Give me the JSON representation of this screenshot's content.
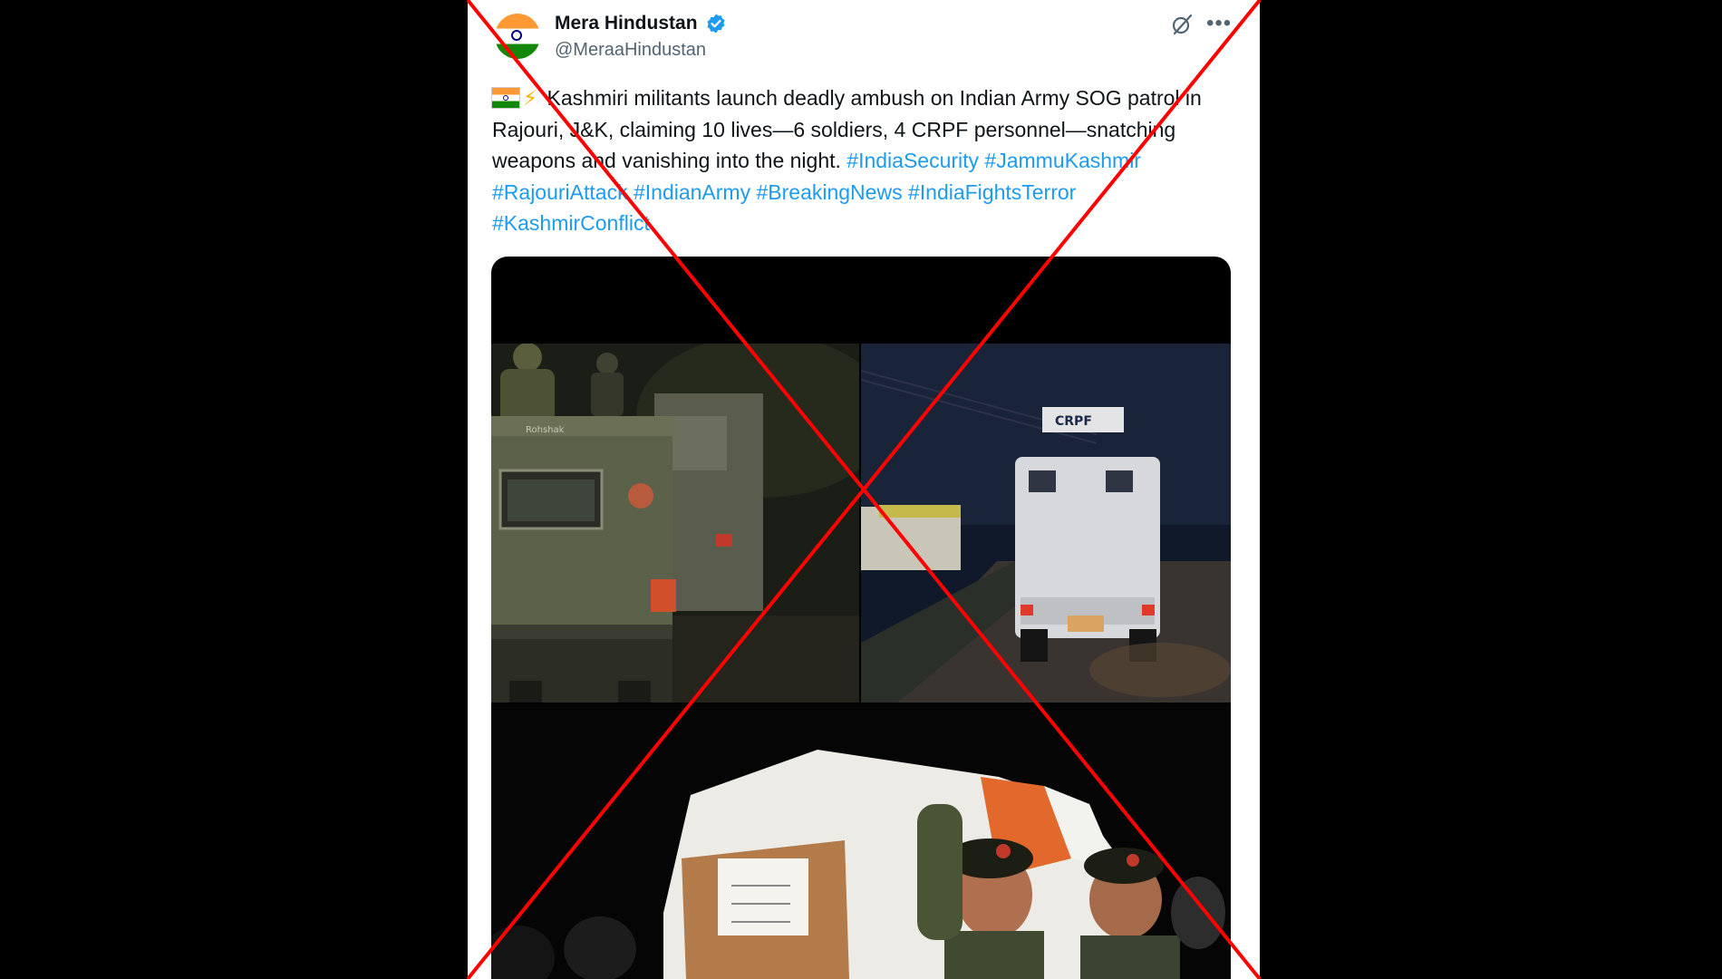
{
  "tweet": {
    "author": {
      "name": "Mera Hindustan",
      "handle": "@MeraaHindustan",
      "avatar_icon": "india-flag-icon",
      "verified": true
    },
    "text_body": "Kashmiri militants launch deadly ambush on Indian Army SOG patrol in Rajouri, J&K, claiming 10 lives—6 soldiers, 4 CRPF personnel—snatching weapons and vanishing into the night.",
    "hashtags": [
      "#IndiaSecurity",
      "#JammuKashmir",
      "#RajouriAttack",
      "#IndianArmy",
      "#BreakingNews",
      "#IndiaFightsTerror",
      "#KashmirConflict"
    ],
    "media": {
      "photo_1": {
        "vehicle_marking": "Rohshak"
      },
      "photo_2": {
        "vehicle_marking": "CRPF"
      }
    }
  },
  "colors": {
    "hashtag": "#1d9bf0",
    "verified_badge": "#1d9bf0",
    "overlay_cross": "#ff0000",
    "saffron": "#FF9933",
    "green": "#138808",
    "navy": "#000080"
  }
}
